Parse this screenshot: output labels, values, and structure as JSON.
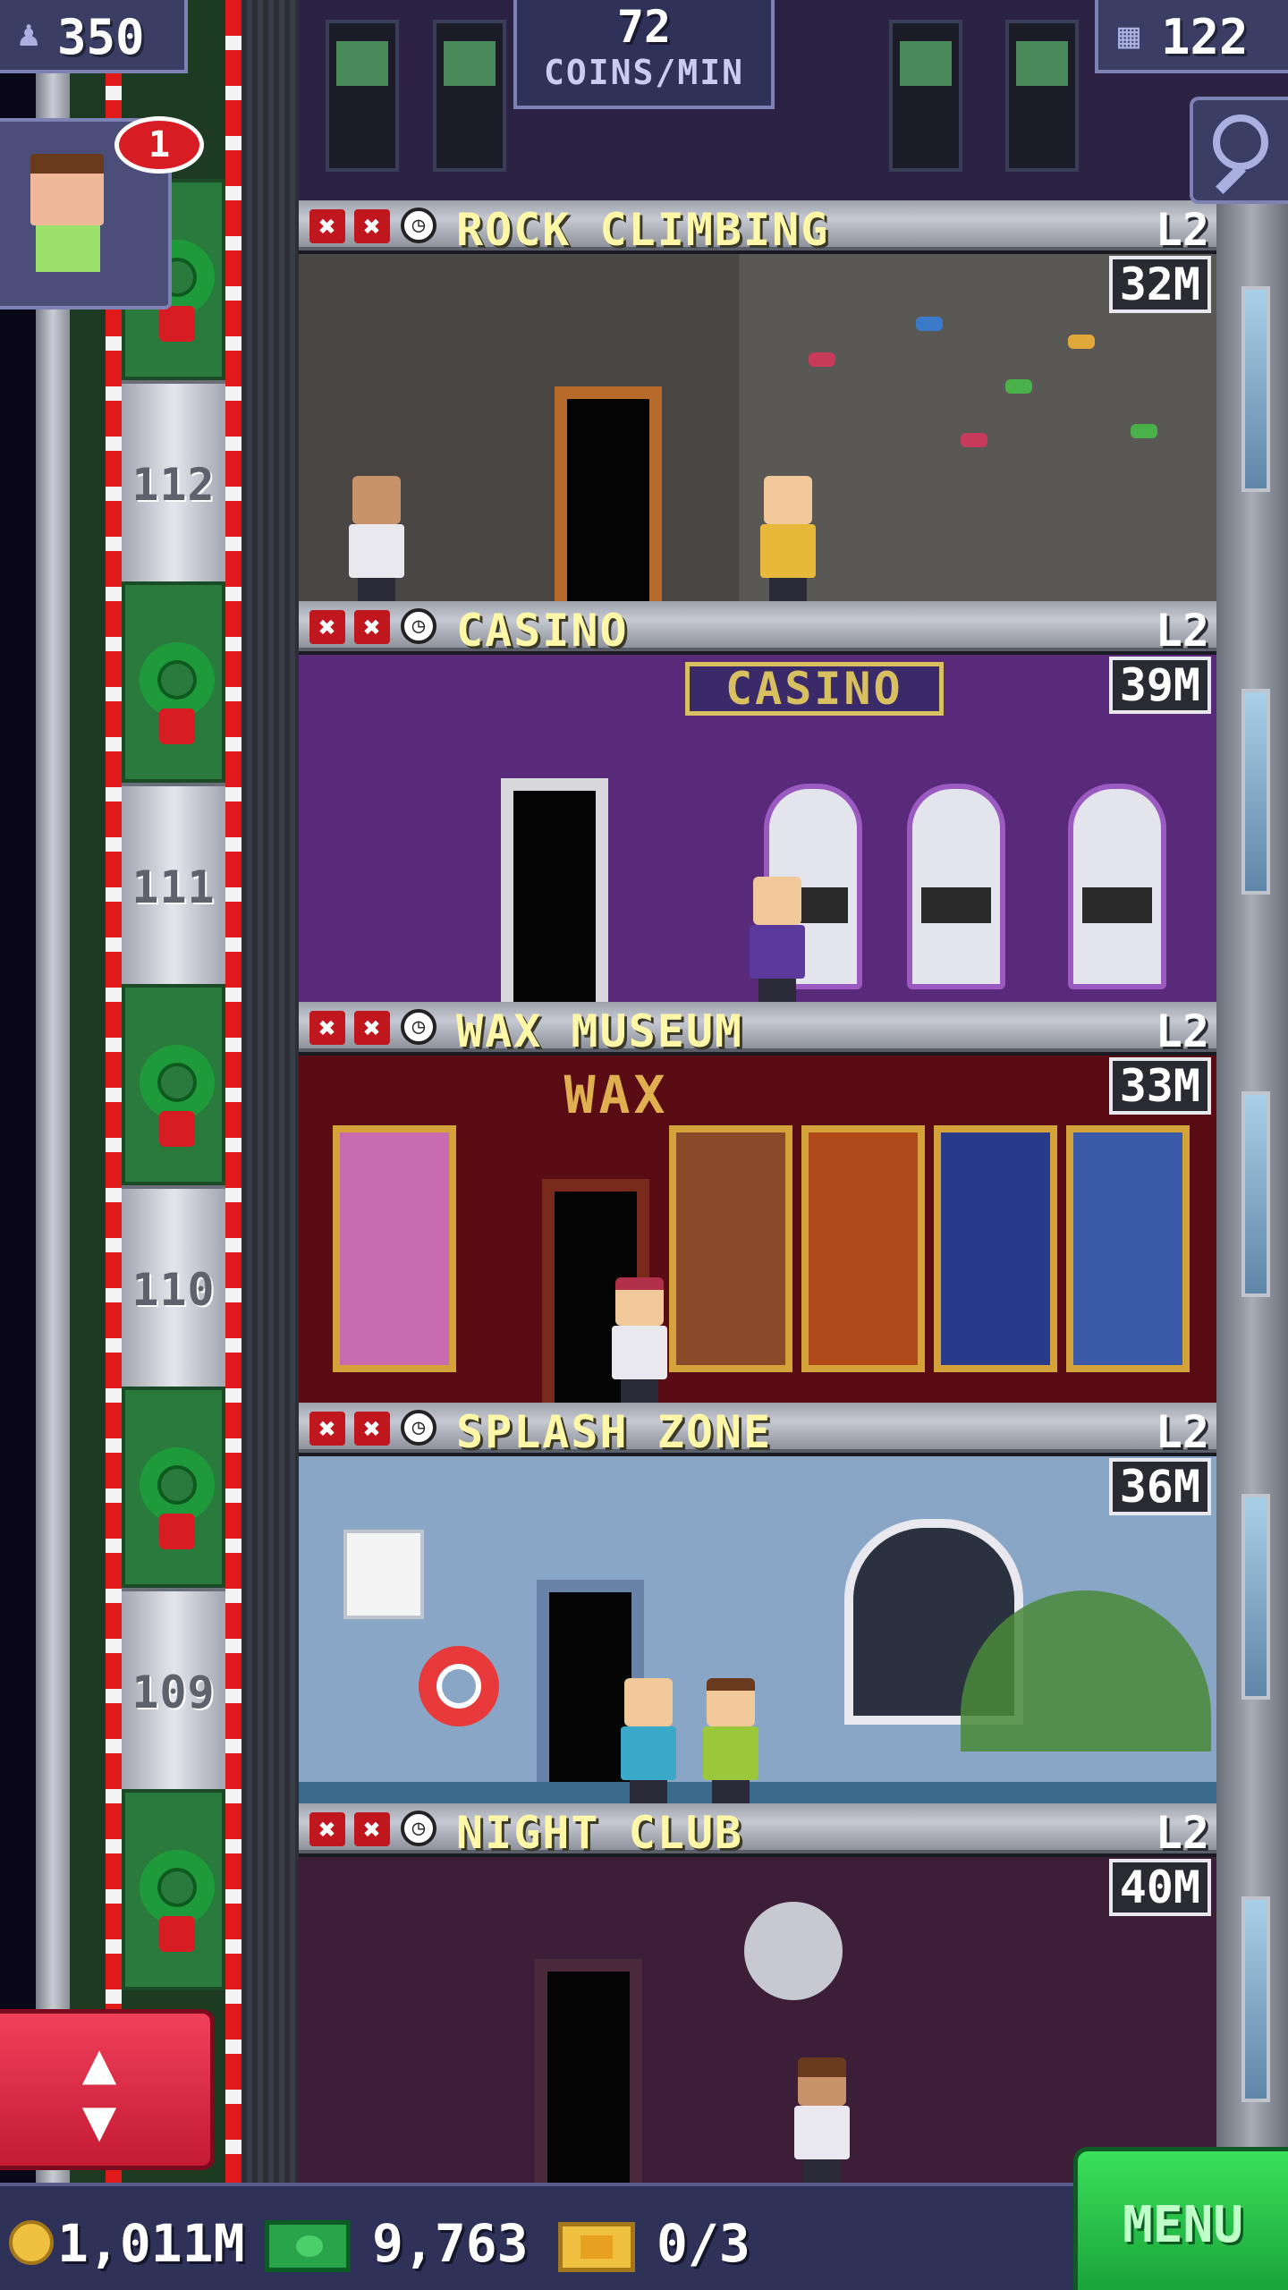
{
  "hud": {
    "population": "350",
    "coins_per_min_value": "72",
    "coins_per_min_label": "COINS/MIN",
    "floor_count": "122"
  },
  "visitor": {
    "notification_count": "1"
  },
  "elevator": {
    "shaft_floors": [
      "112",
      "111",
      "110",
      "109"
    ]
  },
  "floors": [
    {
      "name": "ROCK CLIMBING",
      "level": "L2",
      "stock": "32M"
    },
    {
      "name": "CASINO",
      "level": "L2",
      "stock": "39M",
      "sign": "CASINO"
    },
    {
      "name": "WAX MUSEUM",
      "level": "L2",
      "stock": "33M",
      "sign": "WAX"
    },
    {
      "name": "SPLASH ZONE",
      "level": "L2",
      "stock": "36M"
    },
    {
      "name": "NIGHT CLUB",
      "level": "L2",
      "stock": "40M"
    }
  ],
  "bottom_bar": {
    "coins": "1,011M",
    "bux": "9,763",
    "tickets": "0/3",
    "menu_label": "MENU"
  },
  "icons": {
    "population": "person-icon",
    "floors": "building-icon",
    "zoom": "magnifier-icon",
    "elevator": "up-down-arrows-icon",
    "coin": "coin-icon",
    "bux": "bux-icon",
    "ticket": "vip-ticket-icon"
  },
  "colors": {
    "hud_bg": "#3a3e64",
    "floor_name": "#fff7a8",
    "elevator_red": "#e0203a",
    "menu_green": "#2ad04a"
  }
}
